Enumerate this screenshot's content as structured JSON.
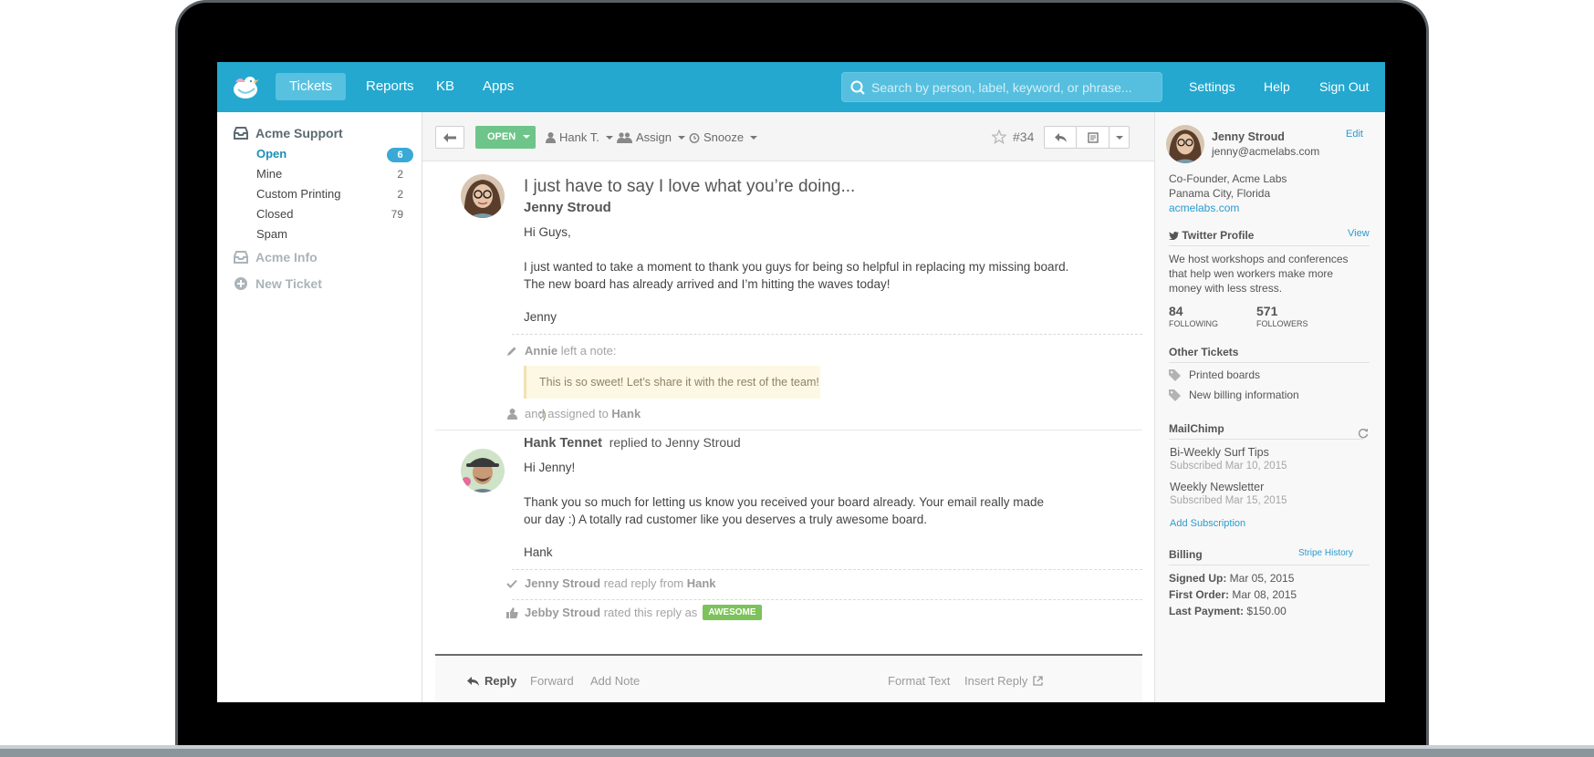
{
  "nav": {
    "tabs": [
      "Tickets",
      "Reports",
      "KB",
      "Apps"
    ],
    "search_placeholder": "Search by person, label, keyword, or phrase...",
    "right_links": [
      "Settings",
      "Help",
      "Sign Out"
    ]
  },
  "sidebar": {
    "mailbox_primary": "Acme Support",
    "folders": [
      {
        "label": "Open",
        "count": "6"
      },
      {
        "label": "Mine",
        "count": "2"
      },
      {
        "label": "Custom Printing",
        "count": "2"
      },
      {
        "label": "Closed",
        "count": "79"
      },
      {
        "label": "Spam",
        "count": ""
      }
    ],
    "mailbox_secondary": "Acme Info",
    "new_ticket": "New Ticket"
  },
  "toolbar": {
    "status": "OPEN",
    "assignee": "Hank T.",
    "assign": "Assign",
    "snooze": "Snooze",
    "ticket_number": "#34"
  },
  "thread": {
    "subject": "I just have to say I love what you’re doing...",
    "msg1": {
      "from": "Jenny Stroud",
      "greeting": "Hi Guys,",
      "body_line1": "I just wanted to take a moment to thank you guys for being so helpful in replacing my missing board.",
      "body_line2": "The new board has already arrived and I’m hitting the waves today!",
      "signoff": "Jenny"
    },
    "note": {
      "author": "Annie",
      "action": "left a note:",
      "text": "This is so sweet! Let’s share it with the rest of the team! :)",
      "assigned_prefix": "and assigned to",
      "assigned_to": "Hank"
    },
    "msg2": {
      "from": "Hank Tennet",
      "action": "replied to Jenny Stroud",
      "greeting": "Hi Jenny!",
      "body_line1": "Thank you so much for letting us know you received your board already. Your email really made",
      "body_line2": "our day :) A totally rad customer like you deserves a truly awesome board.",
      "signoff": "Hank"
    },
    "read": {
      "who": "Jenny Stroud",
      "action": "read reply from",
      "from": "Hank"
    },
    "rated": {
      "who": "Jebby Stroud",
      "action": "rated this reply as",
      "rating": "AWESOME"
    }
  },
  "reply_bar": {
    "reply": "Reply",
    "forward": "Forward",
    "add_note": "Add Note",
    "format_text": "Format Text",
    "insert_reply": "Insert Reply"
  },
  "customer": {
    "name": "Jenny Stroud",
    "email": "jenny@acmelabs.com",
    "edit": "Edit",
    "title": "Co-Founder, Acme Labs",
    "location": "Panama City, Florida",
    "website": "acmelabs.com",
    "twitter_heading": "Twitter Profile",
    "twitter_view": "View",
    "bio_line1": "We host workshops and conferences",
    "bio_line2": "that help wen workers make more",
    "bio_line3": "money with less stress.",
    "following_count": "84",
    "following_label": "FOLLOWING",
    "followers_count": "571",
    "followers_label": "FOLLOWERS",
    "other_tickets_heading": "Other Tickets",
    "other_tickets": [
      "Printed boards",
      "New billing information"
    ],
    "mailchimp_heading": "MailChimp",
    "subscriptions": [
      {
        "name": "Bi-Weekly Surf Tips",
        "date": "Subscribed Mar 10, 2015"
      },
      {
        "name": "Weekly Newsletter",
        "date": "Subscribed Mar 15, 2015"
      }
    ],
    "add_subscription": "Add Subscription",
    "billing_heading": "Billing",
    "stripe_history": "Stripe History",
    "signed_up_label": "Signed Up:",
    "signed_up": "Mar 05, 2015",
    "first_order_label": "First Order:",
    "first_order": "Mar 08, 2015",
    "last_payment_label": "Last Payment:",
    "last_payment": "$150.00"
  },
  "colors": {
    "brand": "#24a8cf",
    "open_status": "#6ec58a",
    "link": "#2a9bd0",
    "awesome_badge": "#7dc25a"
  }
}
